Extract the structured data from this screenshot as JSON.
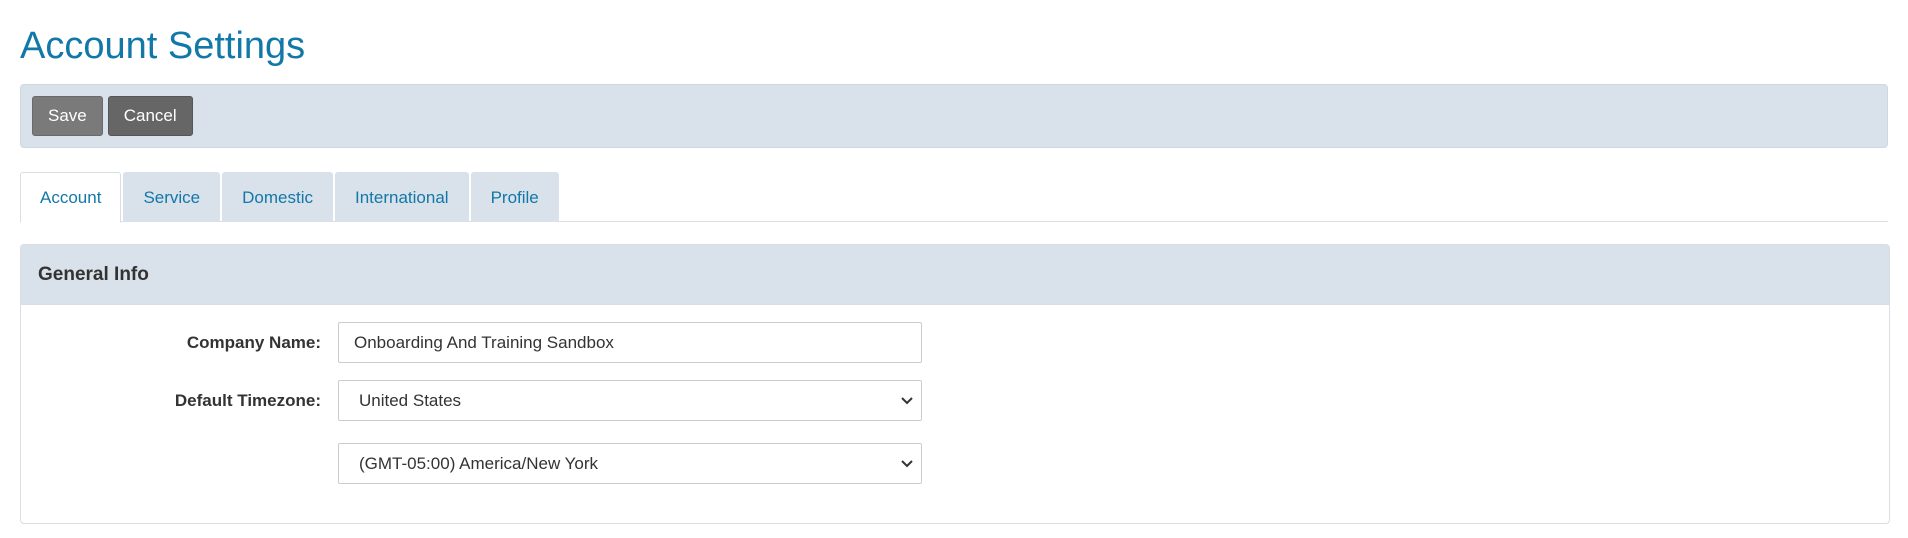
{
  "page": {
    "title": "Account Settings"
  },
  "toolbar": {
    "save_label": "Save",
    "cancel_label": "Cancel"
  },
  "tabs": [
    {
      "label": "Account",
      "active": true
    },
    {
      "label": "Service",
      "active": false
    },
    {
      "label": "Domestic",
      "active": false
    },
    {
      "label": "International",
      "active": false
    },
    {
      "label": "Profile",
      "active": false
    }
  ],
  "general_info": {
    "heading": "General Info",
    "company_name": {
      "label": "Company Name:",
      "value": "Onboarding And Training Sandbox"
    },
    "default_timezone": {
      "label": "Default Timezone:",
      "country_value": "United States",
      "zone_value": "(GMT-05:00) America/New York"
    }
  },
  "colors": {
    "accent": "#1278a8",
    "toolbar_bg": "#d9e1ea",
    "button_save": "#7a7a7a",
    "button_cancel": "#666666"
  }
}
